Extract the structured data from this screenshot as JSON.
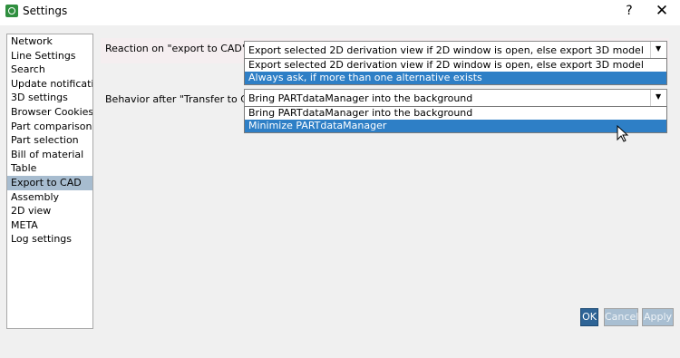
{
  "window": {
    "title": "Settings",
    "help_label": "?",
    "close_label": "✕"
  },
  "nav": {
    "items": [
      {
        "label": "Network"
      },
      {
        "label": "Line Settings"
      },
      {
        "label": "Search"
      },
      {
        "label": "Update notification"
      },
      {
        "label": "3D settings"
      },
      {
        "label": "Browser Cookies"
      },
      {
        "label": "Part comparison"
      },
      {
        "label": "Part selection"
      },
      {
        "label": "Bill of material"
      },
      {
        "label": "Table"
      },
      {
        "label": "Export to CAD"
      },
      {
        "label": "Assembly"
      },
      {
        "label": "2D view"
      },
      {
        "label": "META"
      },
      {
        "label": "Log settings"
      }
    ],
    "selected": "Export to CAD"
  },
  "export_reaction": {
    "label": "Reaction on \"export to CAD\"",
    "value": "Export selected 2D derivation view if 2D window is open, else export 3D model",
    "options": [
      "Export selected 2D derivation view if 2D window is open, else export 3D model",
      "Always ask, if more than one alternative exists"
    ],
    "highlighted": "Always ask, if more than one alternative exists"
  },
  "transfer_behavior": {
    "label": "Behavior after \"Transfer to CAD\":",
    "value": "Bring PARTdataManager into the background",
    "options": [
      "Bring PARTdataManager into the background",
      "Minimize PARTdataManager"
    ],
    "highlighted": "Minimize PARTdataManager"
  },
  "buttons": {
    "ok": "OK",
    "cancel": "Cancel",
    "apply": "Apply"
  },
  "colors": {
    "selection_nav": "#a7bccf",
    "selection_list": "#2e7fc6",
    "ok_button": "#2e6496",
    "disabled_button": "#a9bfd2"
  }
}
